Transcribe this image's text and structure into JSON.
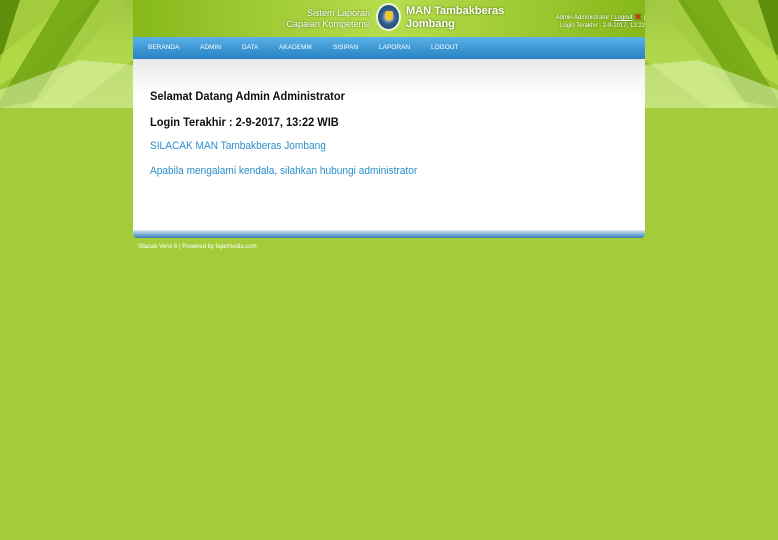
{
  "header": {
    "subtitle_line1": "Sistem Laporan",
    "subtitle_line2": "Capaian Kompetensi",
    "school_line1": "MAN Tambakberas",
    "school_line2": "Jombang",
    "user_name": "Admin Administrator",
    "separator": "|",
    "logout_label": "Logout",
    "last_login_text": "Login Terakhir : 2-9-2017, 13:22"
  },
  "nav": {
    "items": [
      "BERANDA",
      "ADMIN",
      "DATA",
      "AKADEMIK",
      "SISIPAN",
      "LAPORAN",
      "LOGOUT"
    ]
  },
  "main": {
    "welcome": "Selamat Datang Admin Administrator",
    "last_login": "Login Terakhir : 2-9-2017, 13:22 WIB",
    "app_name": "SILACAK MAN Tambakberas Jombang",
    "help_text": "Apabila mengalami kendala, silahkan hubungi administrator"
  },
  "footer": {
    "text": "Silacak Versi 6 | Powered by fajarmedia.com"
  },
  "colors": {
    "background": "#a4cc3a",
    "nav_blue": "#3d97d3",
    "link_blue": "#2a8ec9",
    "logout_x": "#e02020"
  },
  "icons": {
    "logo": "school-emblem-icon",
    "logout": "close-x-icon"
  }
}
